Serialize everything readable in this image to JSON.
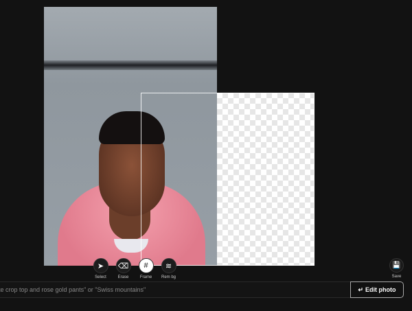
{
  "canvas": {
    "photo_alt": "Portrait photo of man in pink hoodie"
  },
  "toolbar": {
    "tools": [
      {
        "label": "Select",
        "icon": "cursor-icon",
        "glyph": "➤"
      },
      {
        "label": "Erase",
        "icon": "eraser-icon",
        "glyph": "⌫"
      },
      {
        "label": "Frame",
        "icon": "frame-icon",
        "glyph": "#"
      },
      {
        "label": "Rem bg",
        "icon": "layers-icon",
        "glyph": "≋"
      }
    ],
    "active": "Frame"
  },
  "save": {
    "label": "Save",
    "glyph": "💾"
  },
  "prompt": {
    "placeholder": "te crop top and rose gold pants\" or \"Swiss mountains\"",
    "value": ""
  },
  "edit_button": {
    "label": "Edit photo",
    "glyph": "↵"
  }
}
